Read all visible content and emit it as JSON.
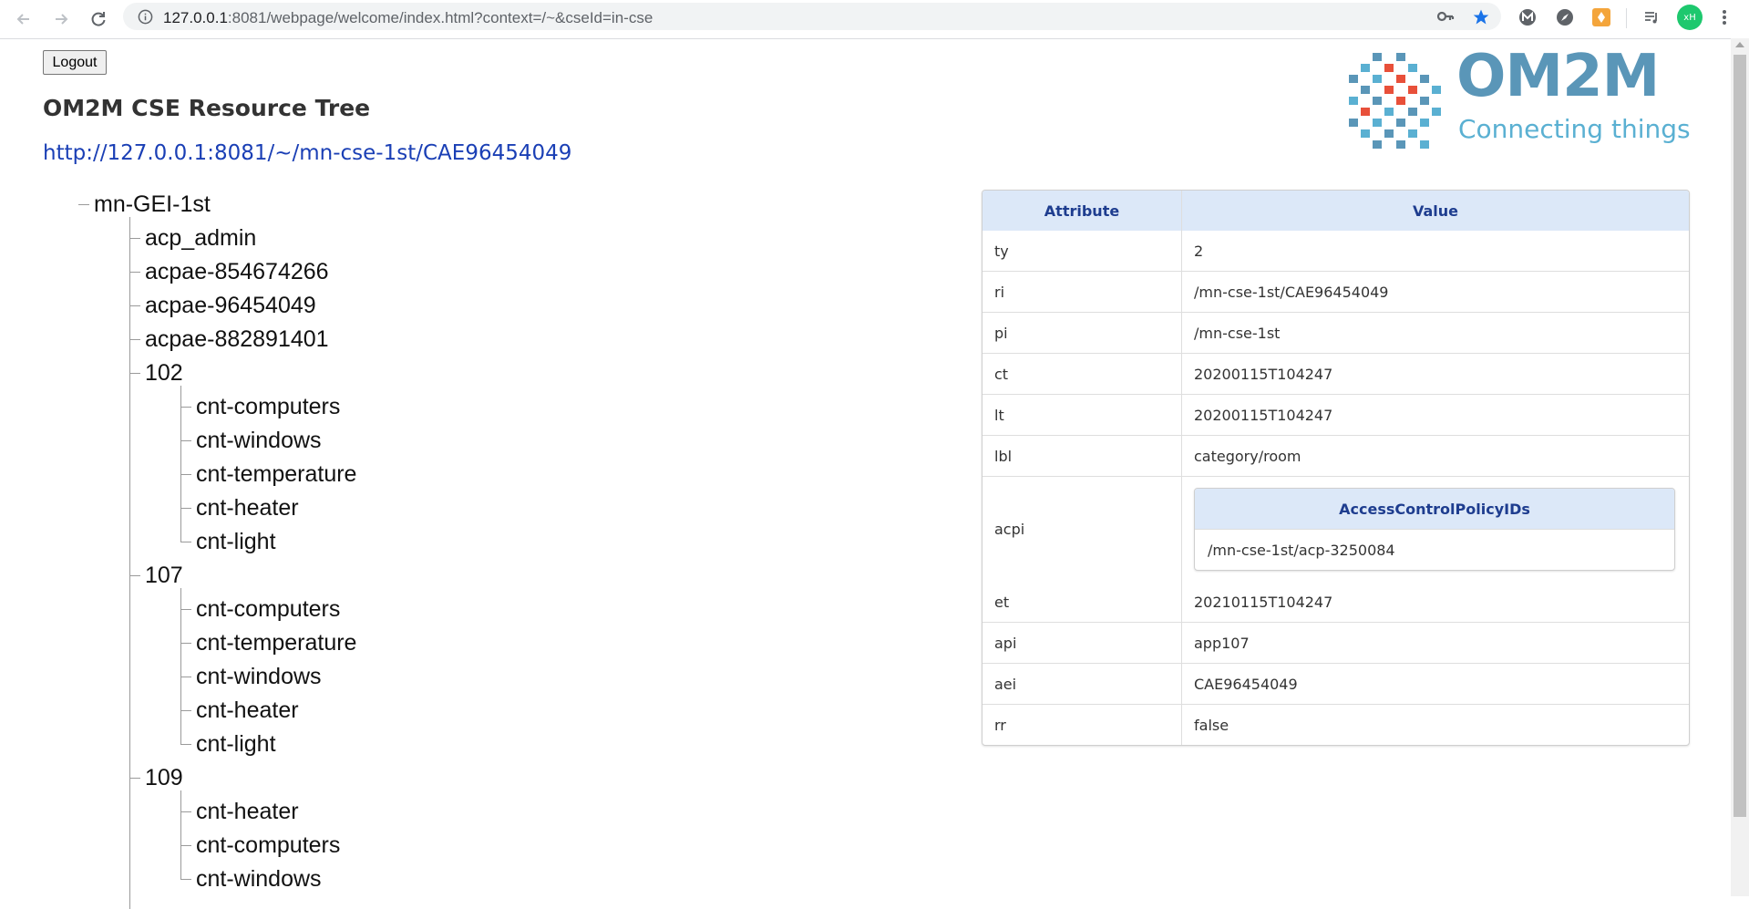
{
  "browser": {
    "url_host": "127.0.0.1",
    "url_rest": ":8081/webpage/welcome/index.html?context=/~&cseId=in-cse",
    "profile_initials": "xH",
    "icons": [
      "back-icon",
      "forward-icon",
      "reload-icon",
      "info-icon",
      "key-icon",
      "star-icon",
      "extension-m-icon",
      "extension-compass-icon",
      "extension-orange-icon",
      "media-queue-icon",
      "profile-avatar",
      "menu-dots-icon"
    ]
  },
  "page": {
    "logout_label": "Logout",
    "title": "OM2M CSE Resource Tree",
    "resource_url": "http://127.0.0.1:8081/~/mn-cse-1st/CAE96454049"
  },
  "logo": {
    "text": "OM2M",
    "tagline": "Connecting things",
    "colors": {
      "primary": "#5a96b8",
      "accent": "#e8503a",
      "light": "#5ab0d2"
    }
  },
  "tree": {
    "root": "mn-GEI-1st",
    "children": [
      {
        "label": "acp_admin",
        "children": []
      },
      {
        "label": "acpae-854674266",
        "children": []
      },
      {
        "label": "acpae-96454049",
        "children": []
      },
      {
        "label": "acpae-882891401",
        "children": []
      },
      {
        "label": "102",
        "children": [
          "cnt-computers",
          "cnt-windows",
          "cnt-temperature",
          "cnt-heater",
          "cnt-light"
        ]
      },
      {
        "label": "107",
        "children": [
          "cnt-computers",
          "cnt-temperature",
          "cnt-windows",
          "cnt-heater",
          "cnt-light"
        ]
      },
      {
        "label": "109",
        "children": [
          "cnt-heater",
          "cnt-computers",
          "cnt-windows"
        ]
      }
    ]
  },
  "attributes": {
    "header": {
      "attribute": "Attribute",
      "value": "Value"
    },
    "rows": [
      {
        "name": "ty",
        "value": "2"
      },
      {
        "name": "ri",
        "value": "/mn-cse-1st/CAE96454049"
      },
      {
        "name": "pi",
        "value": "/mn-cse-1st"
      },
      {
        "name": "ct",
        "value": "20200115T104247"
      },
      {
        "name": "lt",
        "value": "20200115T104247"
      },
      {
        "name": "lbl",
        "value": "category/room"
      }
    ],
    "acpi": {
      "name": "acpi",
      "header": "AccessControlPolicyIDs",
      "value": "/mn-cse-1st/acp-3250084"
    },
    "rows_after": [
      {
        "name": "et",
        "value": "20210115T104247"
      },
      {
        "name": "api",
        "value": "app107"
      },
      {
        "name": "aei",
        "value": "CAE96454049"
      },
      {
        "name": "rr",
        "value": "false"
      }
    ]
  }
}
